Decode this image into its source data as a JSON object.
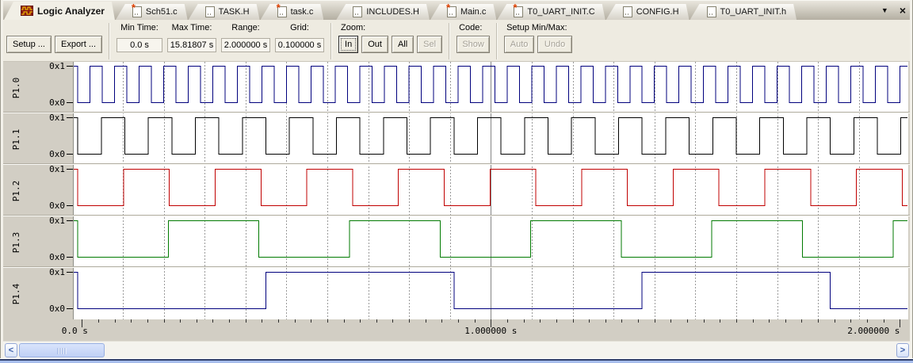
{
  "window": {
    "dropdown_icon": "▼",
    "close_icon": "×",
    "scroll_left_icon": "<",
    "scroll_right_icon": ">"
  },
  "tabs": [
    {
      "label": "Logic Analyzer",
      "icon": "logic-analyzer",
      "active": true
    },
    {
      "label": "Sch51.c",
      "icon": "document-modified",
      "active": false
    },
    {
      "label": "TASK.H",
      "icon": "document",
      "active": false
    },
    {
      "label": "task.c",
      "icon": "document-modified",
      "active": false
    },
    {
      "label": "INCLUDES.H",
      "icon": "document",
      "active": false
    },
    {
      "label": "Main.c",
      "icon": "document-modified",
      "active": false
    },
    {
      "label": "T0_UART_INIT.C",
      "icon": "document-modified",
      "active": false
    },
    {
      "label": "CONFIG.H",
      "icon": "document",
      "active": false
    },
    {
      "label": "T0_UART_INIT.h",
      "icon": "document",
      "active": false
    }
  ],
  "toolbar": {
    "setup_label": "Setup ...",
    "export_label": "Export ...",
    "fields": [
      {
        "label": "Min Time:",
        "value": "0.0 s"
      },
      {
        "label": "Max Time:",
        "value": "15.81807 s"
      },
      {
        "label": "Range:",
        "value": "2.000000 s"
      },
      {
        "label": "Grid:",
        "value": "0.100000 s"
      }
    ],
    "zoom_group": {
      "label": "Zoom:",
      "buttons": [
        {
          "label": "In",
          "enabled": true,
          "focused": true
        },
        {
          "label": "Out",
          "enabled": true,
          "focused": false
        },
        {
          "label": "All",
          "enabled": true,
          "focused": false
        },
        {
          "label": "Sel",
          "enabled": false,
          "focused": false
        }
      ]
    },
    "code_group": {
      "label": "Code:",
      "buttons": [
        {
          "label": "Show",
          "enabled": false,
          "focused": false
        }
      ]
    },
    "minmax_group": {
      "label": "Setup Min/Max:",
      "buttons": [
        {
          "label": "Auto",
          "enabled": false,
          "focused": false
        },
        {
          "label": "Undo",
          "enabled": false,
          "focused": false
        }
      ]
    }
  },
  "chart_data": {
    "type": "line",
    "subtype": "digital-timing-diagram",
    "title": "Logic Analyzer waveforms P1.0 - P1.4",
    "x_range_s": [
      0.0,
      2.0
    ],
    "grid_interval_s": 0.1,
    "major_line_s": 1.0,
    "grid_color": "#9a9a9a",
    "axis_ticks": [
      {
        "t": 0,
        "label": "0.0 s"
      },
      {
        "t": 1,
        "label": "1.000000 s"
      },
      {
        "t": 2,
        "label": "2.000000 s"
      }
    ],
    "channels": [
      {
        "name": "P1.0",
        "high_label": "0x1",
        "low_label": "0x0",
        "color": "#00007d",
        "initial_state": 1,
        "first_toggle_s": 0.01,
        "half_period_s": 0.03
      },
      {
        "name": "P1.1",
        "high_label": "0x1",
        "low_label": "0x0",
        "color": "#000000",
        "initial_state": 1,
        "first_toggle_s": 0.01,
        "half_period_s": 0.0575
      },
      {
        "name": "P1.2",
        "high_label": "0x1",
        "low_label": "0x0",
        "color": "#c00000",
        "initial_state": 1,
        "first_toggle_s": 0.01,
        "half_period_s": 0.112
      },
      {
        "name": "P1.3",
        "high_label": "0x1",
        "low_label": "0x0",
        "color": "#007a00",
        "initial_state": 1,
        "first_toggle_s": 0.01,
        "half_period_s": 0.2215
      },
      {
        "name": "P1.4",
        "high_label": "0x1",
        "low_label": "0x0",
        "color": "#00007d",
        "initial_state": 1,
        "first_toggle_s": 0.01,
        "half_period_s": 0.46
      }
    ]
  }
}
